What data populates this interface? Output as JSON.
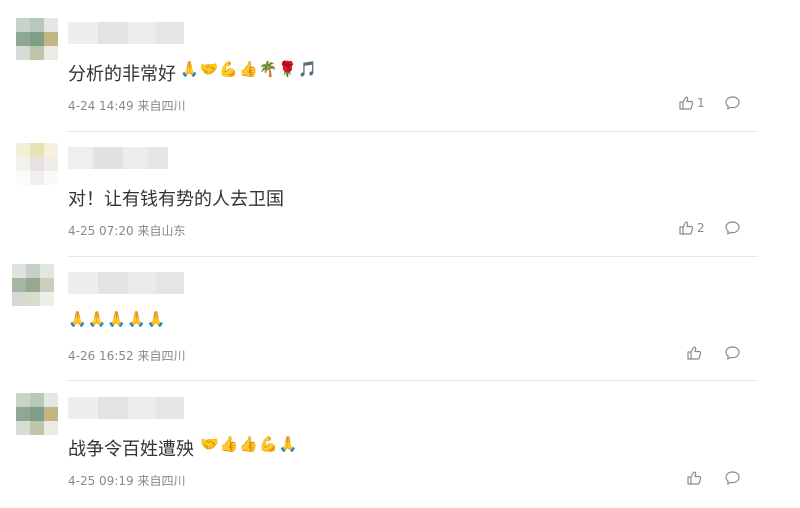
{
  "comments": [
    {
      "text": "分析的非常好",
      "emoji": "🙏🤝💪👍🌴🌹🎵",
      "time": "4-24 14:49",
      "location": "来自四川",
      "likes": "1",
      "avatar_colors": [
        "#c9d3c7",
        "#b8c8bb",
        "#e3e8e3",
        "#8fa896",
        "#7f9e86",
        "#c4b683",
        "#d6dcd6",
        "#bfc5a9",
        "#e9ebe4"
      ]
    },
    {
      "text": "对！让有钱有势的人去卫国",
      "emoji": "",
      "time": "4-25 07:20",
      "location": "来自山东",
      "likes": "2",
      "avatar_colors": [
        "#f2f0d6",
        "#e9e1b2",
        "#f5f1dc",
        "#f3f1ec",
        "#e7e2e4",
        "#f0ece6",
        "#fbfbfa",
        "#f1eef0",
        "#fafafa"
      ]
    },
    {
      "text": "",
      "emoji": "🙏🙏🙏🙏🙏",
      "time": "4-26 16:52",
      "location": "来自四川",
      "likes": "",
      "avatar_colors": [
        "#dfe4df",
        "#c7d0c7",
        "#e2e6e1",
        "#a7b6a3",
        "#97a88e",
        "#c9cfbf",
        "#d4d9d2",
        "#d8dccd",
        "#eceee8"
      ]
    },
    {
      "text": "战争令百姓遭殃",
      "emoji": "🤝👍👍💪🙏",
      "time": "4-25 09:19",
      "location": "来自四川",
      "likes": "",
      "avatar_colors": [
        "#c9d3c7",
        "#b8c8bb",
        "#e3e8e3",
        "#8fa896",
        "#7f9e86",
        "#c4b683",
        "#d6dcd6",
        "#bfc5a9",
        "#e9ebe4"
      ]
    }
  ]
}
